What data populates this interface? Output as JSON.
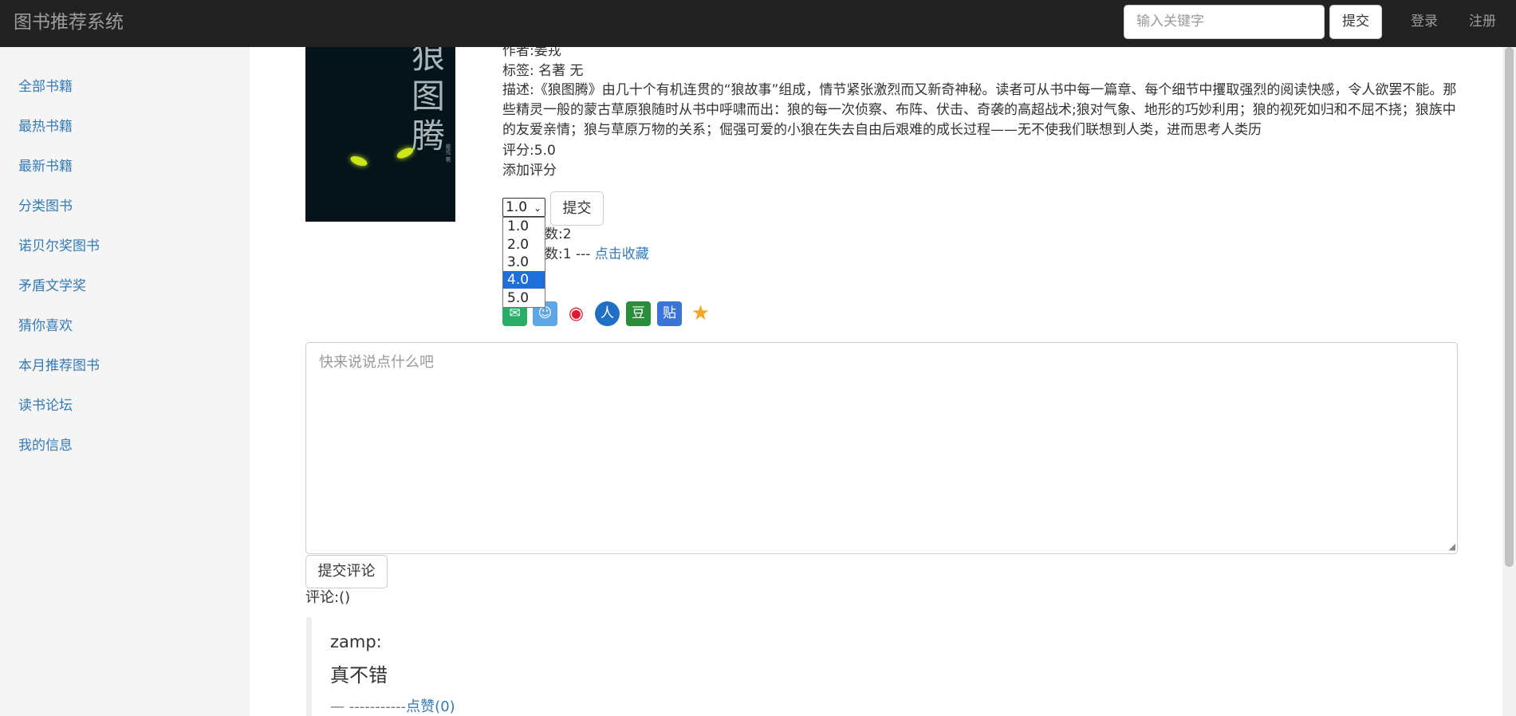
{
  "navbar": {
    "brand": "图书推荐系统",
    "search_placeholder": "输入关键字",
    "search_submit": "提交",
    "login": "登录",
    "register": "注册"
  },
  "sidebar": {
    "items": [
      {
        "label": "全部书籍"
      },
      {
        "label": "最热书籍"
      },
      {
        "label": "最新书籍"
      },
      {
        "label": "分类图书"
      },
      {
        "label": "诺贝尔奖图书"
      },
      {
        "label": "矛盾文学奖"
      },
      {
        "label": "猜你喜欢"
      },
      {
        "label": "本月推荐图书"
      },
      {
        "label": "读书论坛"
      },
      {
        "label": "我的信息"
      }
    ]
  },
  "book": {
    "cover_title": "狼图腾",
    "cover_author": "姜戎 著",
    "author_line": "作者:姜戎",
    "tags_line": "标签: 名著 无",
    "description": "描述:《狼图腾》由几十个有机连贯的“狼故事”组成，情节紧张激烈而又新奇神秘。读者可从书中每一篇章、每个细节中攫取强烈的阅读快感，令人欲罢不能。那些精灵一般的蒙古草原狼随时从书中呼啸而出：狼的每一次侦察、布阵、伏击、奇袭的高超战术;狼对气象、地形的巧妙利用；狼的视死如归和不屈不挠；狼族中的友爱亲情；狼与草原万物的关系；倔强可爱的小狼在失去自由后艰难的成长过程——无不使我们联想到人类，进而思考人类历",
    "score_line": "评分:5.0",
    "add_rating_label": "添加评分",
    "rating_selected": "1.0",
    "rating_submit": "提交",
    "rating_options": [
      "1.0",
      "2.0",
      "3.0",
      "4.0",
      "5.0"
    ],
    "highlighted_option": "4.0",
    "count_line_1_partial": "数:2",
    "count_line_2_partial": "数:1 ---",
    "favorite_link": "点击收藏"
  },
  "share": {
    "icons": [
      {
        "name": "wechat-icon",
        "glyph": "✉",
        "color": "#2aae67"
      },
      {
        "name": "qq-icon",
        "glyph": "☺",
        "color": "#5fa6e6"
      },
      {
        "name": "weibo-icon",
        "glyph": "◉",
        "color": "#e6162d"
      },
      {
        "name": "renren-icon",
        "glyph": "人",
        "color": "#1f6fc5"
      },
      {
        "name": "douban-icon",
        "glyph": "豆",
        "color": "#2a8d3a"
      },
      {
        "name": "tieba-icon",
        "glyph": "贴",
        "color": "#3a74d9"
      },
      {
        "name": "favorite-star-icon",
        "glyph": "★",
        "color": "#f5a623"
      }
    ]
  },
  "comment": {
    "placeholder": "快来说说点什么吧",
    "submit": "提交评论",
    "count_label": "评论:()",
    "items": [
      {
        "user": "zamp:",
        "text": "真不错",
        "footer_prefix": "— -----------",
        "like": "点赞(0)"
      }
    ]
  }
}
